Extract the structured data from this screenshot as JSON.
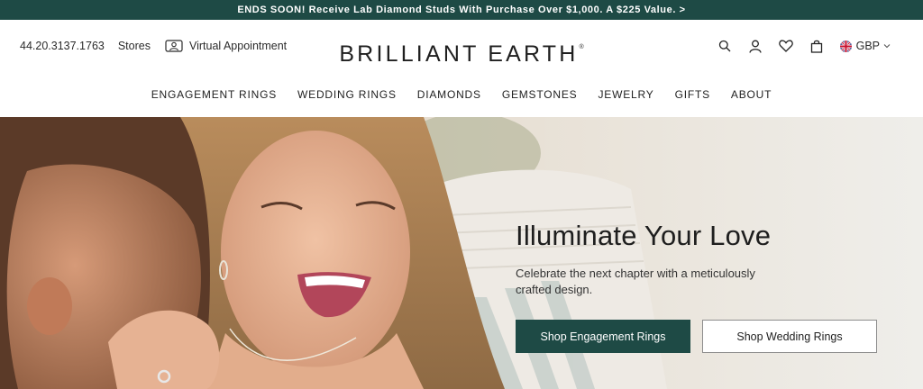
{
  "promo": {
    "text": "ENDS SOON! Receive Lab Diamond Studs With Purchase Over $1,000. A $225 Value. >"
  },
  "utility_left": {
    "phone": "44.20.3137.1763",
    "stores": "Stores",
    "appointment": "Virtual Appointment",
    "appointment_icon": "video-person-icon"
  },
  "logo": {
    "text": "BRILLIANT EARTH",
    "mark": "®"
  },
  "utility_right": {
    "icons": [
      "search-icon",
      "account-icon",
      "heart-icon",
      "bag-icon"
    ],
    "currency": "GBP",
    "flag_icon": "uk-flag-icon"
  },
  "nav": {
    "items": [
      "ENGAGEMENT RINGS",
      "WEDDING RINGS",
      "DIAMONDS",
      "GEMSTONES",
      "JEWELRY",
      "GIFTS",
      "ABOUT"
    ]
  },
  "hero": {
    "title": "Illuminate Your Love",
    "subtitle": "Celebrate the next chapter with a meticulously crafted design.",
    "primary_cta": "Shop Engagement Rings",
    "secondary_cta": "Shop Wedding Rings"
  },
  "colors": {
    "brand": "#1e4a45",
    "text": "#1f1f1f",
    "hero_bg": "#ecebe7"
  }
}
